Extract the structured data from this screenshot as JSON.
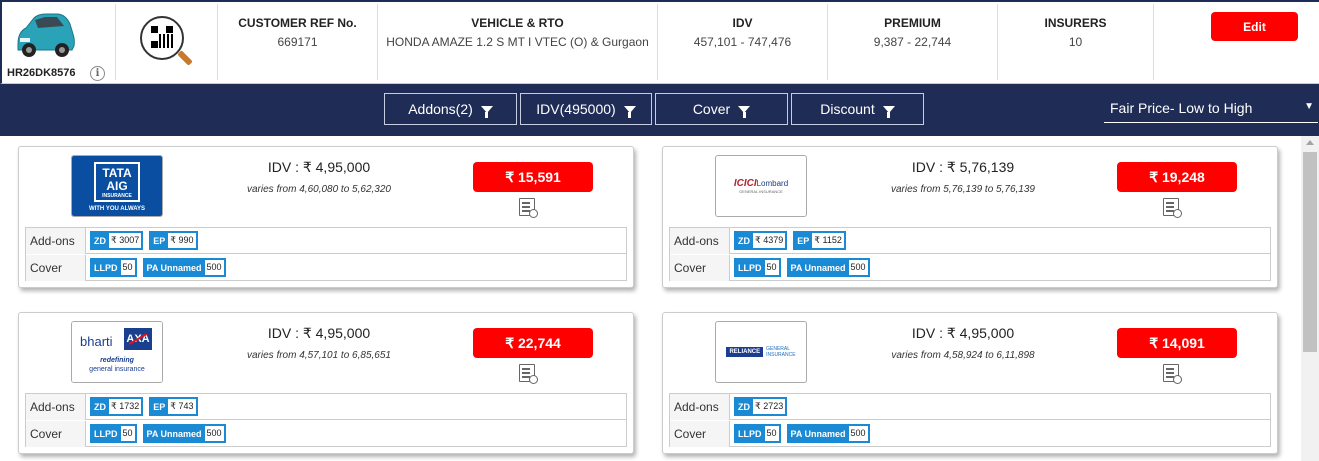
{
  "header": {
    "registration": "HR26DK8576",
    "columns": [
      {
        "label": "CUSTOMER REF No.",
        "value": "669171"
      },
      {
        "label": "VEHICLE & RTO",
        "value": "HONDA AMAZE 1.2 S MT I VTEC (O) & Gurgaon"
      },
      {
        "label": "IDV",
        "value": "457,101 - 747,476"
      },
      {
        "label": "PREMIUM",
        "value": "9,387 - 22,744"
      },
      {
        "label": "INSURERS",
        "value": "10"
      }
    ],
    "edit_label": "Edit"
  },
  "filters": {
    "addons_label": "Addons(2)",
    "idv_label": "IDV(495000)",
    "cover_label": "Cover",
    "discount_label": "Discount",
    "sort_label": "Fair Price- Low to High"
  },
  "colors": {
    "navy": "#1f2c56",
    "accent_red": "#ff0000",
    "chip_blue": "#1a8ad4"
  },
  "cards": [
    {
      "insurer": "tata-aig",
      "logo_text": {
        "line1": "TATA",
        "line2": "AIG",
        "line3": "INSURANCE",
        "tagline": "WITH YOU ALWAYS"
      },
      "idv": "IDV : ₹ 4,95,000",
      "varies": "varies from 4,60,080 to 5,62,320",
      "price": "₹ 15,591",
      "addons_label": "Add-ons",
      "cover_label": "Cover",
      "addons": [
        {
          "code": "ZD",
          "value": "₹ 3007"
        },
        {
          "code": "EP",
          "value": "₹ 990"
        }
      ],
      "covers": [
        {
          "code": "LLPD",
          "value": "50"
        },
        {
          "code": "PA Unnamed",
          "value": "500"
        }
      ]
    },
    {
      "insurer": "icici-lombard",
      "logo_text": {
        "line1": "ICICI",
        "line2": "Lombard",
        "line3": "GENERAL INSURANCE"
      },
      "idv": "IDV : ₹ 5,76,139",
      "varies": "varies from 5,76,139 to 5,76,139",
      "price": "₹ 19,248",
      "addons_label": "Add-ons",
      "cover_label": "Cover",
      "addons": [
        {
          "code": "ZD",
          "value": "₹ 4379"
        },
        {
          "code": "EP",
          "value": "₹ 1152"
        }
      ],
      "covers": [
        {
          "code": "LLPD",
          "value": "50"
        },
        {
          "code": "PA Unnamed",
          "value": "500"
        }
      ]
    },
    {
      "insurer": "bharti-axa",
      "logo_text": {
        "line1": "bharti",
        "line2": "AXA",
        "line3": "redefining",
        "tagline": "general insurance"
      },
      "idv": "IDV : ₹ 4,95,000",
      "varies": "varies from 4,57,101 to 6,85,651",
      "price": "₹ 22,744",
      "addons_label": "Add-ons",
      "cover_label": "Cover",
      "addons": [
        {
          "code": "ZD",
          "value": "₹ 1732"
        },
        {
          "code": "EP",
          "value": "₹ 743"
        }
      ],
      "covers": [
        {
          "code": "LLPD",
          "value": "50"
        },
        {
          "code": "PA Unnamed",
          "value": "500"
        }
      ]
    },
    {
      "insurer": "reliance",
      "logo_text": {
        "line1": "RELIANCE",
        "line2": "GENERAL",
        "line3": "INSURANCE"
      },
      "idv": "IDV : ₹ 4,95,000",
      "varies": "varies from 4,58,924 to 6,11,898",
      "price": "₹ 14,091",
      "addons_label": "Add-ons",
      "cover_label": "Cover",
      "addons": [
        {
          "code": "ZD",
          "value": "₹ 2723"
        }
      ],
      "covers": [
        {
          "code": "LLPD",
          "value": "50"
        },
        {
          "code": "PA Unnamed",
          "value": "500"
        }
      ]
    }
  ]
}
